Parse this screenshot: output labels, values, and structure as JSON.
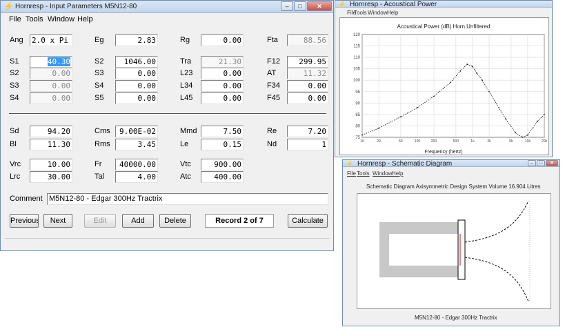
{
  "main": {
    "title": "Hornresp - Input Parameters  M5N12-80",
    "menu": [
      "File",
      "Tools",
      "Window",
      "Help"
    ],
    "rows1": [
      [
        {
          "label": "Ang",
          "value": "2.0 x Pi",
          "style": "left"
        },
        {
          "label": "Eg",
          "value": "2.83"
        },
        {
          "label": "Rg",
          "value": "0.00"
        },
        {
          "label": "Fta",
          "value": "88.56",
          "ro": true
        }
      ],
      [
        {
          "label": "S1",
          "value": "40.30",
          "sel": true
        },
        {
          "label": "S2",
          "value": "1046.00"
        },
        {
          "label": "Tra",
          "value": "21.30",
          "ro": true
        },
        {
          "label": "F12",
          "value": "299.95"
        }
      ],
      [
        {
          "label": "S2",
          "value": "0.00",
          "ro": true
        },
        {
          "label": "S3",
          "value": "0.00"
        },
        {
          "label": "L23",
          "value": "0.00"
        },
        {
          "label": "AT",
          "value": "11.32",
          "ro": true
        }
      ],
      [
        {
          "label": "S3",
          "value": "0.00",
          "ro": true
        },
        {
          "label": "S4",
          "value": "0.00"
        },
        {
          "label": "L34",
          "value": "0.00"
        },
        {
          "label": "F34",
          "value": "0.00"
        }
      ],
      [
        {
          "label": "S4",
          "value": "0.00",
          "ro": true
        },
        {
          "label": "S5",
          "value": "0.00"
        },
        {
          "label": "L45",
          "value": "0.00"
        },
        {
          "label": "F45",
          "value": "0.00"
        }
      ]
    ],
    "rows2": [
      [
        {
          "label": "Sd",
          "value": "94.20"
        },
        {
          "label": "Cms",
          "value": "9.00E-02"
        },
        {
          "label": "Mmd",
          "value": "7.50"
        },
        {
          "label": "Re",
          "value": "7.20"
        }
      ],
      [
        {
          "label": "Bl",
          "value": "11.30"
        },
        {
          "label": "Rms",
          "value": "3.45"
        },
        {
          "label": "Le",
          "value": "0.15"
        },
        {
          "label": "Nd",
          "value": "1"
        }
      ],
      [
        {
          "label": "Vrc",
          "value": "10.00"
        },
        {
          "label": "Fr",
          "value": "40000.00"
        },
        {
          "label": "Vtc",
          "value": "900.00"
        }
      ],
      [
        {
          "label": "Lrc",
          "value": "30.00"
        },
        {
          "label": "Tal",
          "value": "4.00"
        },
        {
          "label": "Atc",
          "value": "400.00"
        }
      ]
    ],
    "comment_label": "Comment",
    "comment_value": "M5N12-80 - Edgar 300Hz Tractrix",
    "buttons": {
      "previous": "Previous",
      "next": "Next",
      "edit": "Edit",
      "add": "Add",
      "delete": "Delete",
      "calculate": "Calculate"
    },
    "record": "Record 2 of 7"
  },
  "chart_win": {
    "title": "Hornresp - Acoustical Power",
    "menu": [
      "File",
      "Tools",
      "Window",
      "Help"
    ],
    "chart_title": "Acoustical Power (dB)  Horn  Unfiltered",
    "xlabel": "Frequency (hertz)"
  },
  "chart_data": {
    "type": "line",
    "title": "Acoustical Power (dB)  Horn  Unfiltered",
    "xlabel": "Frequency (hertz)",
    "ylabel": "",
    "x_scale": "log",
    "ylim": [
      75,
      120
    ],
    "xlim": [
      10,
      20000
    ],
    "yticks": [
      120,
      115,
      110,
      105,
      100,
      95,
      90,
      85,
      80,
      75
    ],
    "xticks": [
      "10",
      "20",
      "50",
      "100",
      "200",
      "500",
      "1k",
      "2k",
      "5k",
      "10k",
      "20k"
    ],
    "series": [
      {
        "x": [
          10,
          20,
          50,
          100,
          200,
          400,
          600,
          800,
          1000,
          1200,
          1500,
          2000,
          3000,
          4000,
          6000,
          8000,
          10000,
          15000,
          20000
        ],
        "y": [
          76,
          79,
          84,
          88,
          93,
          99,
          104,
          107,
          106,
          103,
          100,
          95,
          88,
          83,
          77,
          75,
          76,
          82,
          85
        ]
      }
    ]
  },
  "schem_win": {
    "title": "Hornresp - Schematic Diagram",
    "menu": [
      "File",
      "Tools",
      "Window",
      "Help"
    ],
    "heading": "Schematic Diagram  Axisymmetric Design  System Volume 16.904 Litres",
    "footer": "M5N12-80 - Edgar 300Hz Tractrix"
  },
  "colors": {
    "accent": "#3399ff",
    "close": "#c75050"
  }
}
